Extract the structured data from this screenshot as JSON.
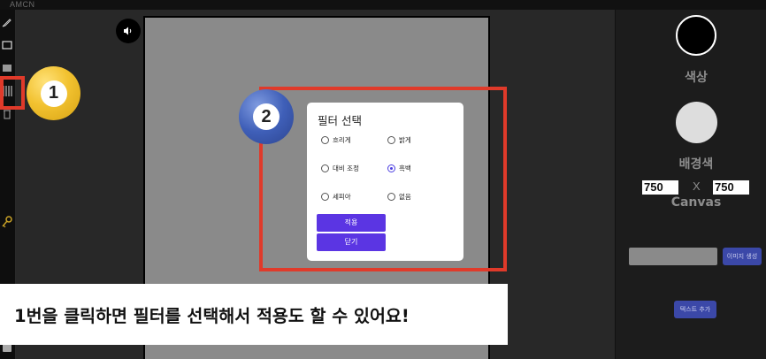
{
  "app": {
    "brand": "AMCN"
  },
  "toolbar": {
    "tools": [
      "pencil-icon",
      "rectangle-icon",
      "fill-icon",
      "filter-icon",
      "trash-icon"
    ],
    "key_icon": "key-icon"
  },
  "canvas": {
    "sound_icon": "speaker-icon"
  },
  "filter_dialog": {
    "title": "필터 선택",
    "options": [
      {
        "label": "흐리게",
        "checked": false
      },
      {
        "label": "밝게",
        "checked": false
      },
      {
        "label": "대비 조정",
        "checked": false
      },
      {
        "label": "흑백",
        "checked": true
      },
      {
        "label": "세피아",
        "checked": false
      },
      {
        "label": "없음",
        "checked": false
      }
    ],
    "apply_label": "적용",
    "close_label": "닫기"
  },
  "right_panel": {
    "color_label": "색상",
    "bg_color_label": "배경색",
    "width_value": "750",
    "size_separator": "X",
    "height_value": "750",
    "canvas_label": "Canvas",
    "image_create_label": "이미지 생성",
    "text_add_label": "텍스트 추가",
    "color_swatch": "#000000",
    "bg_swatch": "#dddddd"
  },
  "annotations": {
    "badge_1": "1",
    "badge_2": "2",
    "caption": "1번을 클릭하면 필터를 선택해서 적용도 할 수 있어요!",
    "box_color": "#e03a2a",
    "badge_1_color": "#f2c230",
    "badge_2_color": "#3f5fb8"
  }
}
